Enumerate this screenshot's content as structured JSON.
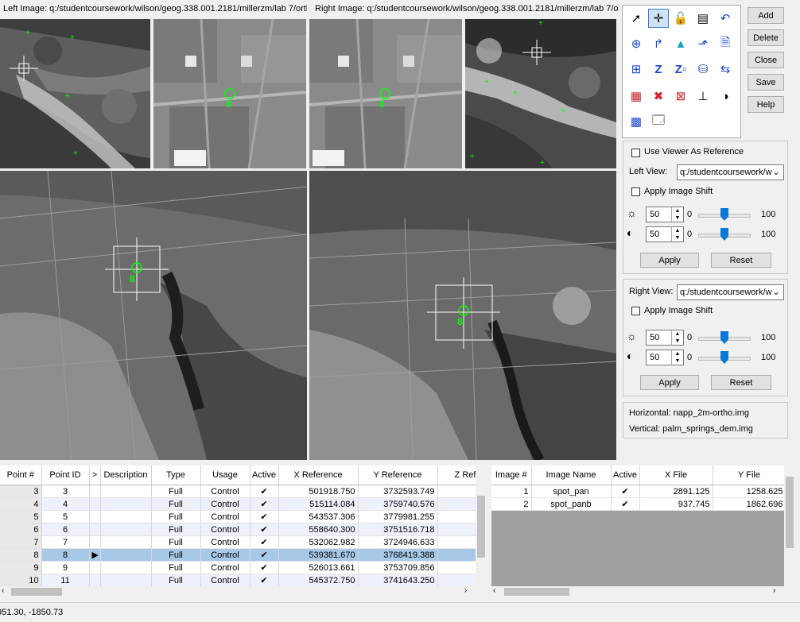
{
  "labels": {
    "left_image": "Left Image: q:/studentcoursework/wilson/geog.338.001.2181/millerzm/lab 7/orth",
    "right_image": "Right Image: q:/studentcoursework/wilson/geog.338.001.2181/millerzm/lab 7/or"
  },
  "point_marker": "8",
  "buttons": {
    "add": "Add",
    "delete": "Delete",
    "close": "Close",
    "save": "Save",
    "help": "Help"
  },
  "tools": [
    "select-arrow-icon",
    "crosshair-icon",
    "lock-icon",
    "table-view-icon",
    "undo-icon",
    "zoom-icon",
    "drive-link-icon",
    "triangle-icon",
    "create-gcp-icon",
    "report-icon",
    "add-point-icon",
    "z-value-icon",
    "z-all-icon",
    "dem-icon",
    "toggle-icon",
    "color-icon",
    "delete-point-icon",
    "clear-icon",
    "threshold-icon",
    "pie-icon",
    "matrix-icon",
    "properties-icon"
  ],
  "left_panel": {
    "use_viewer_ref": "Use Viewer As Reference",
    "left_view_label": "Left View:",
    "left_view_value": "q:/studentcoursework/w",
    "apply_shift": "Apply Image Shift",
    "brightness": {
      "value": "50",
      "min": "0",
      "max": "100",
      "level": 0.5
    },
    "contrast": {
      "value": "50",
      "min": "0",
      "max": "100",
      "level": 0.5
    },
    "apply": "Apply",
    "reset": "Reset"
  },
  "right_panel": {
    "right_view_label": "Right View:",
    "right_view_value": "q:/studentcoursework/w",
    "apply_shift": "Apply Image Shift",
    "brightness": {
      "value": "50",
      "min": "0",
      "max": "100",
      "level": 0.5
    },
    "contrast": {
      "value": "50",
      "min": "0",
      "max": "100",
      "level": 0.5
    },
    "apply": "Apply",
    "reset": "Reset"
  },
  "info": {
    "horizontal": "Horizontal: napp_2m-ortho.img",
    "vertical": "Vertical: palm_springs_dem.img"
  },
  "gcp_table": {
    "headers": [
      "Point #",
      "Point ID",
      ">",
      "Description",
      "Type",
      "Usage",
      "Active",
      "X Reference",
      "Y Reference",
      "Z Ref"
    ],
    "rows": [
      {
        "num": "3",
        "id": "3",
        "arrow": "",
        "desc": "",
        "type": "Full",
        "usage": "Control",
        "active": "✔",
        "x": "501918.750",
        "y": "3732593.749"
      },
      {
        "num": "4",
        "id": "4",
        "arrow": "",
        "desc": "",
        "type": "Full",
        "usage": "Control",
        "active": "✔",
        "x": "515114.084",
        "y": "3759740.576"
      },
      {
        "num": "5",
        "id": "5",
        "arrow": "",
        "desc": "",
        "type": "Full",
        "usage": "Control",
        "active": "✔",
        "x": "543537.306",
        "y": "3779981.255"
      },
      {
        "num": "6",
        "id": "6",
        "arrow": "",
        "desc": "",
        "type": "Full",
        "usage": "Control",
        "active": "✔",
        "x": "558640.300",
        "y": "3751516.718"
      },
      {
        "num": "7",
        "id": "7",
        "arrow": "",
        "desc": "",
        "type": "Full",
        "usage": "Control",
        "active": "✔",
        "x": "532062.982",
        "y": "3724946.633"
      },
      {
        "num": "8",
        "id": "8",
        "arrow": "▶",
        "desc": "",
        "type": "Full",
        "usage": "Control",
        "active": "✔",
        "x": "539381.670",
        "y": "3768419.388"
      },
      {
        "num": "9",
        "id": "9",
        "arrow": "",
        "desc": "",
        "type": "Full",
        "usage": "Control",
        "active": "✔",
        "x": "526013.661",
        "y": "3753709.856"
      },
      {
        "num": "10",
        "id": "11",
        "arrow": "",
        "desc": "",
        "type": "Full",
        "usage": "Control",
        "active": "✔",
        "x": "545372.750",
        "y": "3741643.250"
      }
    ]
  },
  "image_table": {
    "headers": [
      "Image #",
      "Image Name",
      "Active",
      "X File",
      "Y File"
    ],
    "rows": [
      {
        "num": "1",
        "name": "spot_pan",
        "active": "✔",
        "x": "2891.125",
        "y": "1258.625"
      },
      {
        "num": "2",
        "name": "spot_panb",
        "active": "✔",
        "x": "937.745",
        "y": "1862.696"
      }
    ]
  },
  "status": "951.30, -1850.73"
}
